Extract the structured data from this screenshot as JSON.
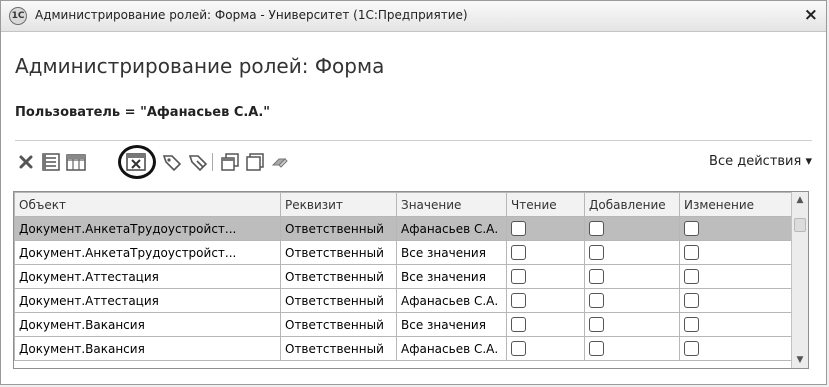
{
  "window": {
    "logo_text": "1C",
    "title": "Администрирование ролей: Форма - Университет  (1С:Предприятие)",
    "close_label": "×"
  },
  "form": {
    "title": "Администрирование ролей: Форма",
    "filter": "Пользователь = \"Афанасьев С.А.\""
  },
  "toolbar": {
    "icons": [
      "delete-icon",
      "list-icon",
      "table-settings-icon",
      "table-filter-icon",
      "tag-icon",
      "untag-icon",
      "copy-icon",
      "window-icon",
      "eraser-icon"
    ],
    "highlighted_icon": "table-filter-icon",
    "all_actions_label": "Все действия ▾"
  },
  "grid": {
    "columns": [
      "Объект",
      "Реквизит",
      "Значение",
      "Чтение",
      "Добавление",
      "Изменение"
    ],
    "selected_row": 0,
    "rows": [
      {
        "object": "Документ.АнкетаТрудоустройст...",
        "attr": "Ответственный",
        "value": "Афанасьев С.А.",
        "read": false,
        "add": false,
        "change": false
      },
      {
        "object": "Документ.АнкетаТрудоустройст...",
        "attr": "Ответственный",
        "value": "Все значения",
        "read": false,
        "add": false,
        "change": false
      },
      {
        "object": "Документ.Аттестация",
        "attr": "Ответственный",
        "value": "Все значения",
        "read": false,
        "add": false,
        "change": false
      },
      {
        "object": "Документ.Аттестация",
        "attr": "Ответственный",
        "value": "Афанасьев С.А.",
        "read": false,
        "add": false,
        "change": false
      },
      {
        "object": "Документ.Вакансия",
        "attr": "Ответственный",
        "value": "Все значения",
        "read": false,
        "add": false,
        "change": false
      },
      {
        "object": "Документ.Вакансия",
        "attr": "Ответственный",
        "value": "Афанасьев С.А.",
        "read": false,
        "add": false,
        "change": false
      }
    ]
  },
  "scrollbar": {
    "up": "▲",
    "down": "▼"
  }
}
